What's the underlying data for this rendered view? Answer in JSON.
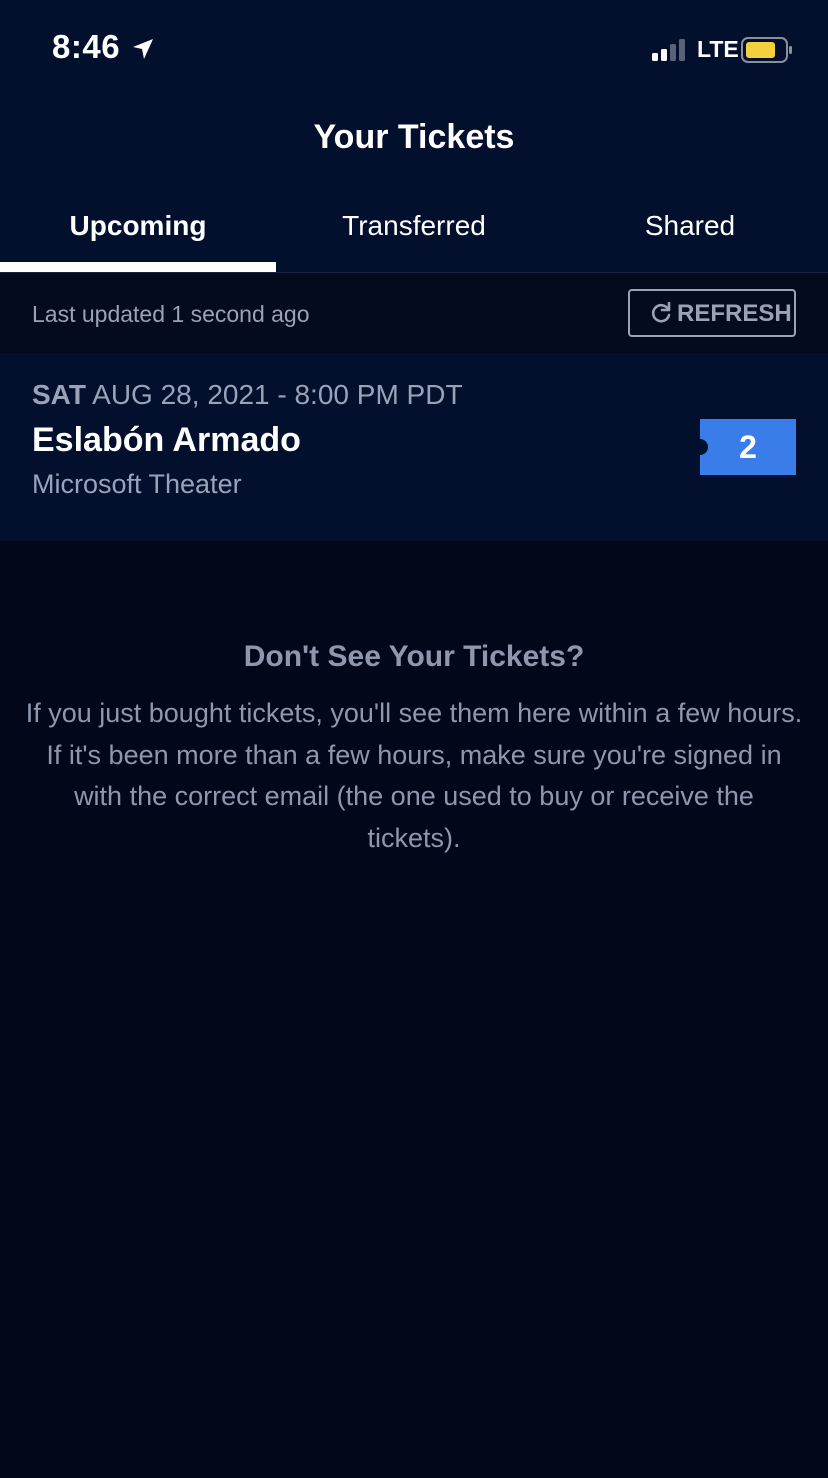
{
  "status_bar": {
    "time": "8:46",
    "network": "LTE",
    "icons": [
      "location-arrow-icon",
      "signal-icon",
      "battery-icon"
    ]
  },
  "header": {
    "title": "Your Tickets"
  },
  "tabs": [
    {
      "label": "Upcoming",
      "active": true
    },
    {
      "label": "Transferred",
      "active": false
    },
    {
      "label": "Shared",
      "active": false
    }
  ],
  "update_bar": {
    "last_updated": "Last updated 1 second ago",
    "refresh_label": "REFRESH"
  },
  "event": {
    "day": "SAT",
    "date": "AUG 28, 2021 - 8:00 PM PDT",
    "artist": "Eslabón Armado",
    "venue": "Microsoft Theater",
    "ticket_count": "2"
  },
  "help": {
    "title": "Don't See Your Tickets?",
    "body": "If you just bought tickets, you'll see them here within a few hours. If it's been more than a few hours, make sure you're signed in with the correct email (the one used to buy or receive the tickets)."
  },
  "colors": {
    "background": "#03071a",
    "header_bg": "#02102e",
    "accent": "#3a7de8",
    "muted_text": "#9aa2b8"
  }
}
